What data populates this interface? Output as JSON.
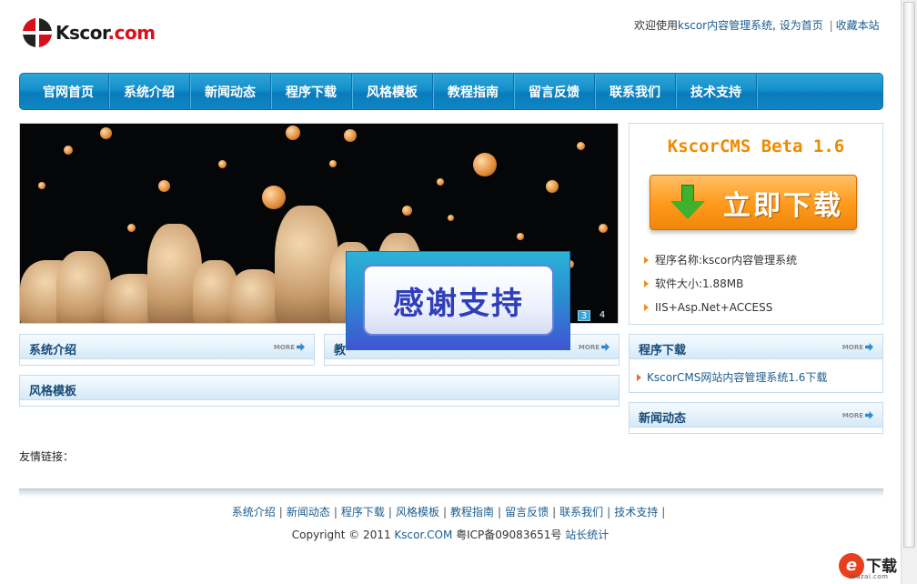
{
  "logo": {
    "text_main": "Kscor",
    "text_tld": ".com"
  },
  "toplinks": {
    "welcome": "欢迎使用",
    "sitename": "kscor内容管理系统",
    "comma": ",",
    "sethome": "设为首页",
    "favorite": "收藏本站",
    "sep": "|"
  },
  "nav": {
    "items": [
      "官网首页",
      "系统介绍",
      "新闻动态",
      "程序下载",
      "风格模板",
      "教程指南",
      "留言反馈",
      "联系我们",
      "技术支持"
    ]
  },
  "banner": {
    "pager": [
      "3",
      "4"
    ]
  },
  "popup": {
    "text": "感谢支持"
  },
  "download_box": {
    "version": "KscorCMS Beta 1.6",
    "button_label": "立即下载",
    "info": [
      "程序名称:kscor内容管理系统",
      "软件大小:1.88MB",
      "IIS+Asp.Net+ACCESS"
    ]
  },
  "sections": {
    "intro": {
      "title": "系统介绍",
      "more": "MORE"
    },
    "tutorial": {
      "title": "教",
      "more": "MORE"
    },
    "templates": {
      "title": "风格模板"
    },
    "downloads": {
      "title": "程序下载",
      "more": "MORE",
      "items": [
        "KscorCMS网站内容管理系统1.6下载"
      ]
    },
    "news": {
      "title": "新闻动态",
      "more": "MORE"
    }
  },
  "friend_links": {
    "label": "友情链接："
  },
  "footer": {
    "nav": [
      "系统介绍",
      "新闻动态",
      "程序下载",
      "风格模板",
      "教程指南",
      "留言反馈",
      "联系我们",
      "技术支持"
    ],
    "sep": "|",
    "copyright_prefix": "Copyright © 2011 ",
    "brand": "Kscor.COM",
    "icp": " 粤ICP备09083651号 ",
    "stats": "站长统计"
  },
  "watermark": {
    "logo": "e",
    "text": "下载",
    "sub": "xiazai.com"
  },
  "colors": {
    "nav_blue": "#1390cb",
    "accent_orange": "#ff9c1f",
    "link_blue": "#1b5c8f",
    "version_orange": "#f08a00"
  }
}
